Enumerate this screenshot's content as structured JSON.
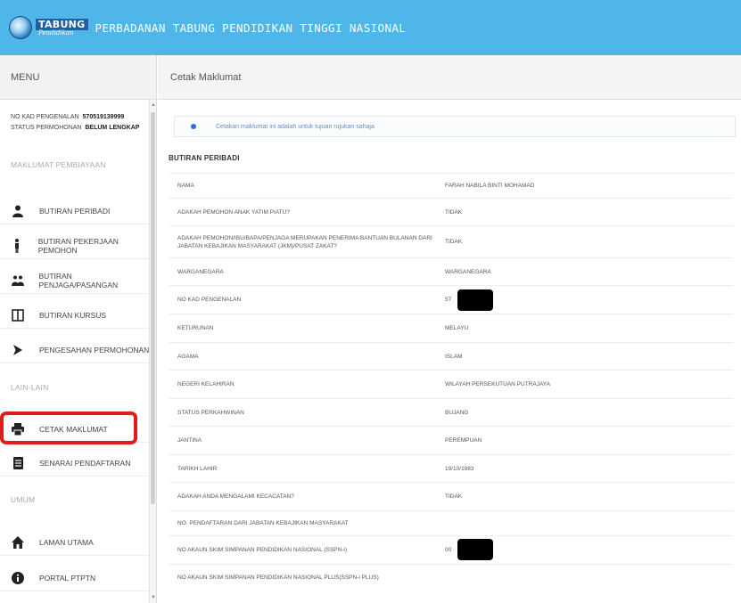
{
  "header": {
    "logo_main": "TABUNG",
    "logo_sub": "Pendidikan",
    "title": "PERBADANAN TABUNG PENDIDIKAN TINGGI NASIONAL",
    "bg_color": "#4fb6ea"
  },
  "sidebar": {
    "menu_title": "MENU",
    "kad_label": "NO KAD PENGENALAN",
    "kad_value": "570519139999",
    "status_label": "STATUS PERMOHONAN",
    "status_value": "BELUM LENGKAP",
    "sections": [
      {
        "label": "MAKLUMAT PEMBIAYAAN"
      },
      {
        "label": "LAIN-LAIN"
      },
      {
        "label": "UMUM"
      }
    ],
    "items": [
      {
        "label": "BUTIRAN PERIBADI",
        "icon": "person-icon"
      },
      {
        "label": "BUTIRAN PEKERJAAN PEMOHON",
        "icon": "standing-person-icon"
      },
      {
        "label": "BUTIRAN PENJAGA/PASANGAN",
        "icon": "group-icon"
      },
      {
        "label": "BUTIRAN KURSUS",
        "icon": "book-icon"
      },
      {
        "label": "PENGESAHAN PERMOHONAN",
        "icon": "arrow-right-icon"
      },
      {
        "label": "CETAK MAKLUMAT",
        "icon": "printer-icon"
      },
      {
        "label": "SENARAI PENDAFTARAN",
        "icon": "document-icon"
      },
      {
        "label": "LAMAN UTAMA",
        "icon": "home-icon"
      },
      {
        "label": "PORTAL PTPTN",
        "icon": "info-icon"
      }
    ],
    "highlight_color": "#e21c1c"
  },
  "main": {
    "page_title": "Cetak Maklumat",
    "info_text": "Cetakan maklumat ini adalah untuk tujuan rujukan sahaja",
    "section_title": "BUTIRAN PERIBADI",
    "rows": [
      {
        "label": "NAMA",
        "value": "FARAH NABILA BINTI MOHAMAD"
      },
      {
        "label": "ADAKAH PEMOHON ANAK YATIM PIATU?",
        "value": "TIDAK"
      },
      {
        "label": "ADAKAH PEMOHON/IBU/BAPA/PENJAGA MERUPAKAN PENERIMA BANTUAN BULANAN DARI JABATAN KEBAJIKAN MASYARAKAT (JKM)/PUSAT ZAKAT?",
        "value": "TIDAK"
      },
      {
        "label": "WARGANEGARA",
        "value": "WARGANEGARA"
      },
      {
        "label": "NO KAD PENGENALAN",
        "value": "57"
      },
      {
        "label": "KETURUNAN",
        "value": "MELAYU"
      },
      {
        "label": "AGAMA",
        "value": "ISLAM"
      },
      {
        "label": "NEGERI KELAHIRAN",
        "value": "WILAYAH PERSEKUTUAN PUTRAJAYA"
      },
      {
        "label": "STATUS PERKAHWINAN",
        "value": "BUJANG"
      },
      {
        "label": "JANTINA",
        "value": "PEREMPUAN"
      },
      {
        "label": "TARIKH LAHIR",
        "value": "19/10/1983"
      },
      {
        "label": "ADAKAH ANDA MENGALAMI KECACATAN?",
        "value": "TIDAK"
      },
      {
        "label": "NO. PENDAFTARAN DARI JABATAN KEBAJIKAN MASYARAKAT",
        "value": ""
      },
      {
        "label": "NO AKAUN SKIM SIMPANAN PENDIDIKAN NASIONAL (SSPN-i)",
        "value": "00"
      },
      {
        "label": "NO AKAUN SKIM SIMPANAN PENDIDIKAN NASIONAL PLUS(SSPN-i PLUS)",
        "value": ""
      }
    ]
  }
}
